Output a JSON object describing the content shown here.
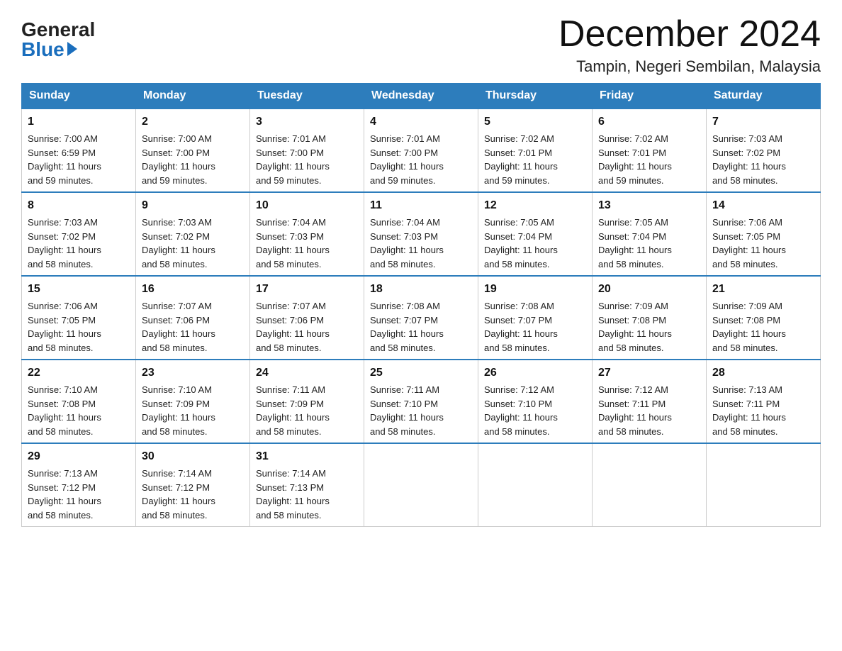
{
  "logo": {
    "general": "General",
    "blue": "Blue"
  },
  "title": "December 2024",
  "location": "Tampin, Negeri Sembilan, Malaysia",
  "days_of_week": [
    "Sunday",
    "Monday",
    "Tuesday",
    "Wednesday",
    "Thursday",
    "Friday",
    "Saturday"
  ],
  "weeks": [
    [
      {
        "day": "1",
        "sunrise": "7:00 AM",
        "sunset": "6:59 PM",
        "daylight": "11 hours and 59 minutes."
      },
      {
        "day": "2",
        "sunrise": "7:00 AM",
        "sunset": "7:00 PM",
        "daylight": "11 hours and 59 minutes."
      },
      {
        "day": "3",
        "sunrise": "7:01 AM",
        "sunset": "7:00 PM",
        "daylight": "11 hours and 59 minutes."
      },
      {
        "day": "4",
        "sunrise": "7:01 AM",
        "sunset": "7:00 PM",
        "daylight": "11 hours and 59 minutes."
      },
      {
        "day": "5",
        "sunrise": "7:02 AM",
        "sunset": "7:01 PM",
        "daylight": "11 hours and 59 minutes."
      },
      {
        "day": "6",
        "sunrise": "7:02 AM",
        "sunset": "7:01 PM",
        "daylight": "11 hours and 59 minutes."
      },
      {
        "day": "7",
        "sunrise": "7:03 AM",
        "sunset": "7:02 PM",
        "daylight": "11 hours and 58 minutes."
      }
    ],
    [
      {
        "day": "8",
        "sunrise": "7:03 AM",
        "sunset": "7:02 PM",
        "daylight": "11 hours and 58 minutes."
      },
      {
        "day": "9",
        "sunrise": "7:03 AM",
        "sunset": "7:02 PM",
        "daylight": "11 hours and 58 minutes."
      },
      {
        "day": "10",
        "sunrise": "7:04 AM",
        "sunset": "7:03 PM",
        "daylight": "11 hours and 58 minutes."
      },
      {
        "day": "11",
        "sunrise": "7:04 AM",
        "sunset": "7:03 PM",
        "daylight": "11 hours and 58 minutes."
      },
      {
        "day": "12",
        "sunrise": "7:05 AM",
        "sunset": "7:04 PM",
        "daylight": "11 hours and 58 minutes."
      },
      {
        "day": "13",
        "sunrise": "7:05 AM",
        "sunset": "7:04 PM",
        "daylight": "11 hours and 58 minutes."
      },
      {
        "day": "14",
        "sunrise": "7:06 AM",
        "sunset": "7:05 PM",
        "daylight": "11 hours and 58 minutes."
      }
    ],
    [
      {
        "day": "15",
        "sunrise": "7:06 AM",
        "sunset": "7:05 PM",
        "daylight": "11 hours and 58 minutes."
      },
      {
        "day": "16",
        "sunrise": "7:07 AM",
        "sunset": "7:06 PM",
        "daylight": "11 hours and 58 minutes."
      },
      {
        "day": "17",
        "sunrise": "7:07 AM",
        "sunset": "7:06 PM",
        "daylight": "11 hours and 58 minutes."
      },
      {
        "day": "18",
        "sunrise": "7:08 AM",
        "sunset": "7:07 PM",
        "daylight": "11 hours and 58 minutes."
      },
      {
        "day": "19",
        "sunrise": "7:08 AM",
        "sunset": "7:07 PM",
        "daylight": "11 hours and 58 minutes."
      },
      {
        "day": "20",
        "sunrise": "7:09 AM",
        "sunset": "7:08 PM",
        "daylight": "11 hours and 58 minutes."
      },
      {
        "day": "21",
        "sunrise": "7:09 AM",
        "sunset": "7:08 PM",
        "daylight": "11 hours and 58 minutes."
      }
    ],
    [
      {
        "day": "22",
        "sunrise": "7:10 AM",
        "sunset": "7:08 PM",
        "daylight": "11 hours and 58 minutes."
      },
      {
        "day": "23",
        "sunrise": "7:10 AM",
        "sunset": "7:09 PM",
        "daylight": "11 hours and 58 minutes."
      },
      {
        "day": "24",
        "sunrise": "7:11 AM",
        "sunset": "7:09 PM",
        "daylight": "11 hours and 58 minutes."
      },
      {
        "day": "25",
        "sunrise": "7:11 AM",
        "sunset": "7:10 PM",
        "daylight": "11 hours and 58 minutes."
      },
      {
        "day": "26",
        "sunrise": "7:12 AM",
        "sunset": "7:10 PM",
        "daylight": "11 hours and 58 minutes."
      },
      {
        "day": "27",
        "sunrise": "7:12 AM",
        "sunset": "7:11 PM",
        "daylight": "11 hours and 58 minutes."
      },
      {
        "day": "28",
        "sunrise": "7:13 AM",
        "sunset": "7:11 PM",
        "daylight": "11 hours and 58 minutes."
      }
    ],
    [
      {
        "day": "29",
        "sunrise": "7:13 AM",
        "sunset": "7:12 PM",
        "daylight": "11 hours and 58 minutes."
      },
      {
        "day": "30",
        "sunrise": "7:14 AM",
        "sunset": "7:12 PM",
        "daylight": "11 hours and 58 minutes."
      },
      {
        "day": "31",
        "sunrise": "7:14 AM",
        "sunset": "7:13 PM",
        "daylight": "11 hours and 58 minutes."
      },
      null,
      null,
      null,
      null
    ]
  ],
  "labels": {
    "sunrise": "Sunrise:",
    "sunset": "Sunset:",
    "daylight": "Daylight:"
  }
}
